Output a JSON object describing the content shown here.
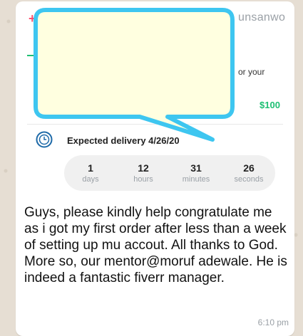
{
  "card": {
    "handle_partial": "unsanwo",
    "description_partial": "or your",
    "price": "$100",
    "plus_symbol": "+",
    "delivery_label": "Expected delivery 4/26/20",
    "countdown": [
      {
        "value": "1",
        "unit": "days"
      },
      {
        "value": "12",
        "unit": "hours"
      },
      {
        "value": "31",
        "unit": "minutes"
      },
      {
        "value": "26",
        "unit": "seconds"
      }
    ]
  },
  "message": {
    "text": "Guys, please kindly help congratulate me as i got my first order after less than a week of setting up mu accout. All thanks to God. More so, our mentor@moruf adewale. He is indeed a fantastic fiverr manager.",
    "time": "6:10 pm"
  },
  "colors": {
    "accent_green": "#1dbf73",
    "censor_fill": "#ffffe0",
    "censor_border": "#3ec6f0",
    "clock_icon": "#1e6aa8"
  },
  "icons": {
    "clock": "clock-icon",
    "plus": "plus-icon"
  }
}
